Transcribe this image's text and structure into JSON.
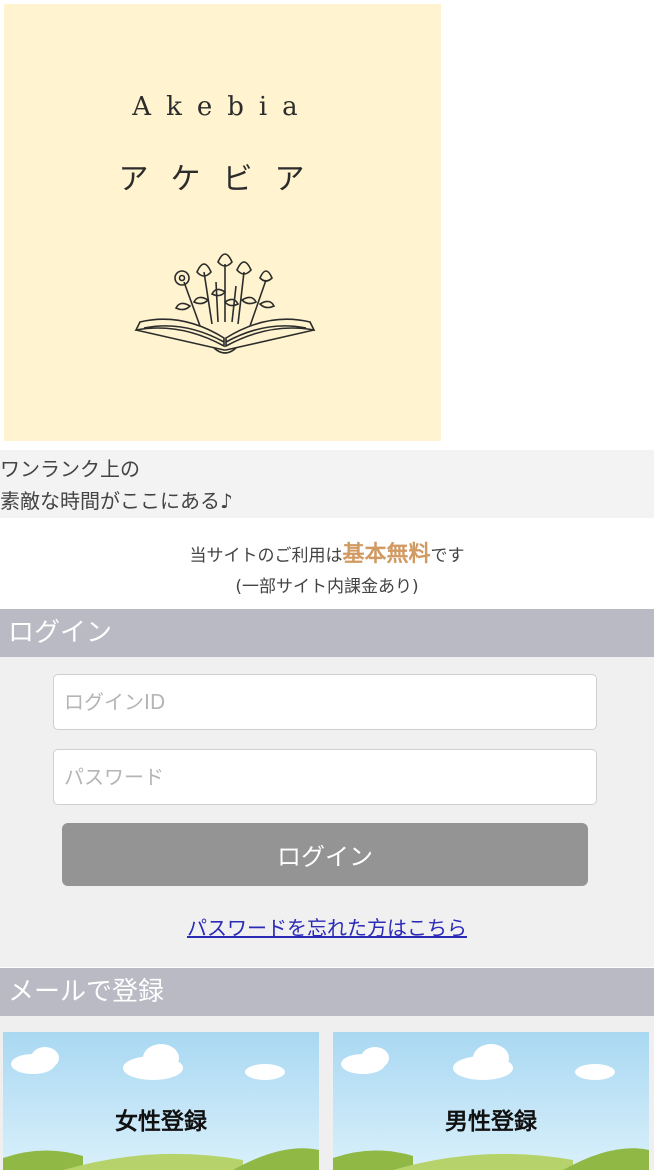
{
  "logo": {
    "name_en": "Akebia",
    "name_ja": "アケビア"
  },
  "tagline": {
    "line1": "ワンランク上の",
    "line2": "素敵な時間がここにある♪"
  },
  "notice": {
    "prefix": "当サイトのご利用は",
    "highlight": "基本無料",
    "suffix": "です",
    "line2": "(一部サイト内課金あり)"
  },
  "login": {
    "heading": "ログイン",
    "id_placeholder": "ログインID",
    "password_placeholder": "パスワード",
    "button_label": "ログイン",
    "forgot_link": "パスワードを忘れた方はこちら"
  },
  "register": {
    "heading": "メールで登録",
    "female_label": "女性登録",
    "male_label": "男性登録"
  },
  "colors": {
    "logo_bg": "#fff4cf",
    "section_header": "#b9bac4",
    "free_highlight": "#d19a63",
    "login_button": "#949494",
    "link": "#2b2bb8",
    "sky": "#bfe3f7",
    "grass": "#9cc548"
  }
}
